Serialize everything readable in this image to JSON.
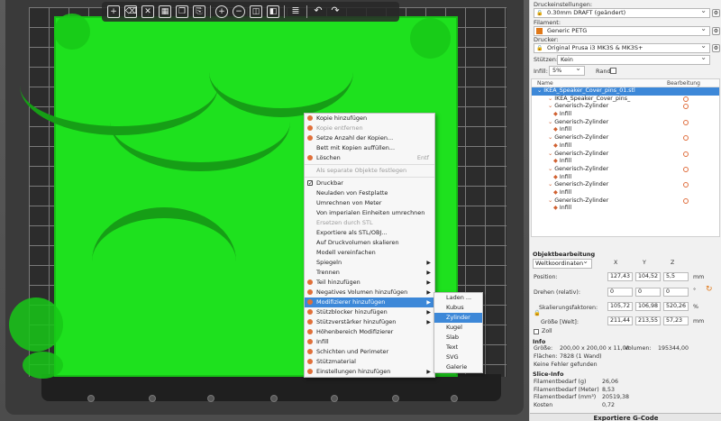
{
  "toolbar": {
    "icons": [
      "add-icon",
      "delete-icon",
      "delete-all-icon",
      "arrange-icon",
      "copy-icon",
      "paste-icon",
      "add-instance-icon",
      "remove-instance-icon",
      "split-objects-icon",
      "split-parts-icon",
      "layers-icon",
      "undo-icon",
      "redo-icon"
    ]
  },
  "context_menu": {
    "items": [
      {
        "label": "Kopie hinzufügen",
        "disabled": false,
        "icon": true
      },
      {
        "label": "Kopie entfernen",
        "disabled": true,
        "icon": true
      },
      {
        "label": "Setze Anzahl der Kopien...",
        "disabled": false,
        "icon": true
      },
      {
        "label": "Bett mit Kopien auffüllen...",
        "disabled": false,
        "icon": false
      },
      {
        "label": "Löschen",
        "disabled": false,
        "icon": true,
        "shortcut": "Entf"
      },
      {
        "sep": true
      },
      {
        "label": "Als separate Objekte festlegen",
        "disabled": true,
        "icon": false
      },
      {
        "sep": true
      },
      {
        "label": "Druckbar",
        "disabled": false,
        "check": true
      },
      {
        "label": "Neuladen von Festplatte",
        "disabled": false
      },
      {
        "label": "Umrechnen von Meter",
        "disabled": false
      },
      {
        "label": "Von imperialen Einheiten umrechnen",
        "disabled": false
      },
      {
        "label": "Ersetzen durch STL",
        "disabled": true
      },
      {
        "label": "Exportiere als STL/OBJ...",
        "disabled": false
      },
      {
        "label": "Auf Druckvolumen skalieren",
        "disabled": false
      },
      {
        "label": "Modell vereinfachen",
        "disabled": false
      },
      {
        "label": "Spiegeln",
        "disabled": false,
        "submenu": true
      },
      {
        "label": "Trennen",
        "disabled": false,
        "submenu": true
      },
      {
        "label": "Teil hinzufügen",
        "disabled": false,
        "icon": true,
        "submenu": true
      },
      {
        "label": "Negatives Volumen hinzufügen",
        "disabled": false,
        "icon": true,
        "submenu": true
      },
      {
        "label": "Modifizierer hinzufügen",
        "disabled": false,
        "icon": true,
        "submenu": true,
        "highlight": true
      },
      {
        "label": "Stützblocker hinzufügen",
        "disabled": false,
        "icon": true,
        "submenu": true
      },
      {
        "label": "Stützverstärker hinzufügen",
        "disabled": false,
        "icon": true,
        "submenu": true
      },
      {
        "label": "Höhenbereich Modifizierer",
        "disabled": false,
        "icon": true
      },
      {
        "label": "Infill",
        "disabled": false,
        "icon": true
      },
      {
        "label": "Schichten und Perimeter",
        "disabled": false,
        "icon": true
      },
      {
        "label": "Stützmaterial",
        "disabled": false,
        "icon": true
      },
      {
        "label": "Einstellungen hinzufügen",
        "disabled": false,
        "icon": true,
        "submenu": true
      }
    ]
  },
  "submenu": {
    "items": [
      {
        "label": "Laden ..."
      },
      {
        "label": "Kubus"
      },
      {
        "label": "Zylinder",
        "highlight": true
      },
      {
        "label": "Kugel"
      },
      {
        "label": "Slab"
      },
      {
        "label": "Text"
      },
      {
        "label": "SVG"
      },
      {
        "label": "Galerie"
      }
    ]
  },
  "panel": {
    "print_settings_label": "Druckeinstellungen:",
    "print_settings_value": "0.30mm DRAFT (geändert)",
    "filament_label": "Filament:",
    "filament_value": "Generic PETG",
    "filament_color": "#e07818",
    "printer_label": "Drucker:",
    "printer_value": "Original Prusa i3 MK3S & MK3S+",
    "supports_label": "Stützen:",
    "supports_value": "Kein",
    "infill_label": "Infill:",
    "infill_value": "5%",
    "brim_label": "Rand:",
    "tree_header_name": "Name",
    "tree_header_edit": "Bearbeitung",
    "tree": [
      {
        "label": "IKEA_Speaker_Cover_pins_01.stl",
        "indent": 1,
        "selected": true,
        "edit": false
      },
      {
        "label": "IKEA_Speaker_Cover_pins_",
        "indent": 3,
        "edit": true
      },
      {
        "label": "Generisch-Zylinder",
        "indent": 3,
        "edit": true
      },
      {
        "label": "Infill",
        "indent": 4,
        "edit": false
      },
      {
        "label": "Generisch-Zylinder",
        "indent": 3,
        "edit": true
      },
      {
        "label": "Infill",
        "indent": 4,
        "edit": false
      },
      {
        "label": "Generisch-Zylinder",
        "indent": 3,
        "edit": true
      },
      {
        "label": "Infill",
        "indent": 4,
        "edit": false
      },
      {
        "label": "Generisch-Zylinder",
        "indent": 3,
        "edit": true
      },
      {
        "label": "Infill",
        "indent": 4,
        "edit": false
      },
      {
        "label": "Generisch-Zylinder",
        "indent": 3,
        "edit": true
      },
      {
        "label": "Infill",
        "indent": 4,
        "edit": false
      },
      {
        "label": "Generisch-Zylinder",
        "indent": 3,
        "edit": true
      },
      {
        "label": "Infill",
        "indent": 4,
        "edit": false
      },
      {
        "label": "Generisch-Zylinder",
        "indent": 3,
        "edit": true
      },
      {
        "label": "Infill",
        "indent": 4,
        "edit": false
      }
    ],
    "object_edit_title": "Objektbearbeitung",
    "coord_system": "Weltkoordinaten",
    "axis_x": "X",
    "axis_y": "Y",
    "axis_z": "Z",
    "position_label": "Position:",
    "position": [
      "127,43",
      "104,52",
      "5,5"
    ],
    "position_unit": "mm",
    "rotate_label": "Drehen (relativ):",
    "rotate": [
      "0",
      "0",
      "0"
    ],
    "rotate_unit": "°",
    "scale_label": "Skalierungsfaktoren:",
    "scale": [
      "105,72",
      "106,98",
      "520,26"
    ],
    "scale_unit": "%",
    "size_label": "Größe [Welt]:",
    "size": [
      "211,44",
      "213,55",
      "57,23"
    ],
    "size_unit": "mm",
    "inch_label": "Zoll",
    "info_title": "Info",
    "info_size_label": "Größe:",
    "info_size_value": "200,00 x 200,00 x 11,00",
    "info_volume_label": "Volumen:",
    "info_volume_value": "195344,00",
    "info_facets_label": "Flächen:",
    "info_facets_value": "7828 (1 Wand)",
    "info_errors": "Keine Fehler gefunden",
    "slice_title": "Slice-Info",
    "slice_rows": [
      {
        "label": "Filamentbedarf (g)",
        "value": "26,06"
      },
      {
        "label": "Filamentbedarf (Meter)",
        "value": "8,53"
      },
      {
        "label": "Filamentbedarf (mm³)",
        "value": "20519,38"
      },
      {
        "label": "Kosten",
        "value": "0,72"
      }
    ],
    "export_label": "Exportiere G-Code"
  }
}
